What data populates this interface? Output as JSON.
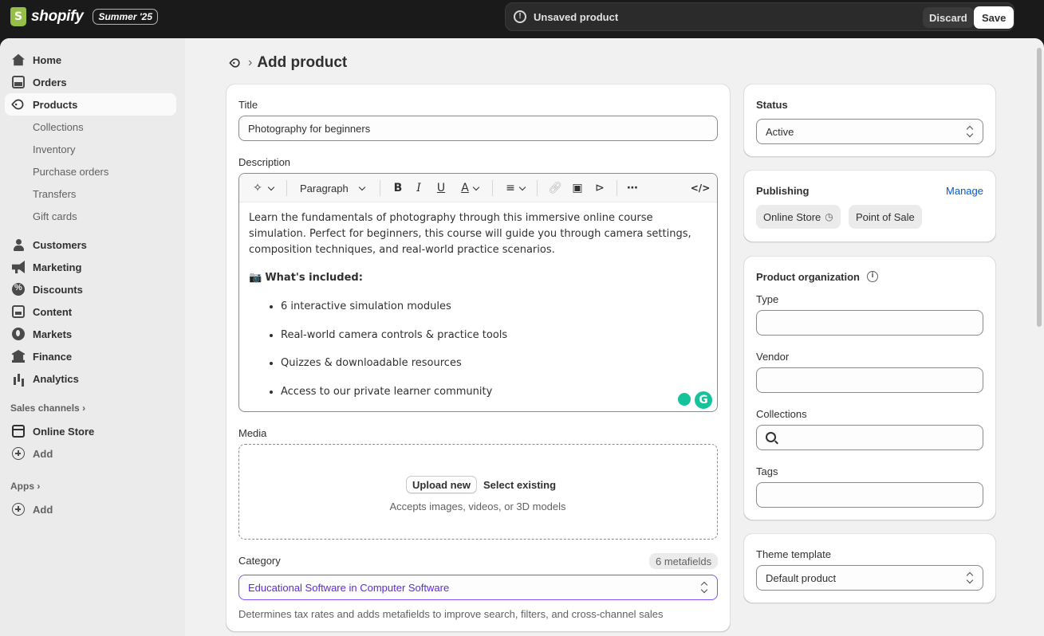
{
  "app": {
    "logo_text": "shopify",
    "badge": "Summer '25"
  },
  "save_bar": {
    "message": "Unsaved product",
    "discard_label": "Discard",
    "save_label": "Save"
  },
  "sidebar": {
    "home": "Home",
    "orders": "Orders",
    "products": "Products",
    "product_subitems": [
      "Collections",
      "Inventory",
      "Purchase orders",
      "Transfers",
      "Gift cards"
    ],
    "customers": "Customers",
    "marketing": "Marketing",
    "discounts": "Discounts",
    "content": "Content",
    "markets": "Markets",
    "finance": "Finance",
    "analytics": "Analytics",
    "sales_channels_label": "Sales channels",
    "online_store": "Online Store",
    "add_channel": "Add",
    "apps_label": "Apps",
    "add_app": "Add"
  },
  "page": {
    "title": "Add product"
  },
  "product": {
    "title_label": "Title",
    "title_value": "Photography for beginners",
    "description_label": "Description",
    "toolbar": {
      "paragraph": "Paragraph"
    },
    "description": {
      "intro": "Learn the fundamentals of photography through this immersive online course simulation. Perfect for beginners, this course will guide you through camera settings, composition techniques, and real-world practice scenarios.",
      "heading_emoji": "📷",
      "heading": "What's included:",
      "bullets": [
        "6 interactive simulation modules",
        "Real-world camera controls & practice tools",
        "Quizzes & downloadable resources",
        "Access to our private learner community"
      ]
    },
    "media_label": "Media",
    "upload_new": "Upload new",
    "select_existing": "Select existing",
    "media_hint": "Accepts images, videos, or 3D models",
    "category_label": "Category",
    "metafields_badge": "6 metafields",
    "category_value": "Educational Software in Computer Software",
    "category_hint": "Determines tax rates and adds metafields to improve search, filters, and cross-channel sales"
  },
  "status_card": {
    "label": "Status",
    "value": "Active"
  },
  "publishing": {
    "label": "Publishing",
    "manage": "Manage",
    "channels": [
      "Online Store",
      "Point of Sale"
    ]
  },
  "organization": {
    "label": "Product organization",
    "type_label": "Type",
    "type_value": "",
    "vendor_label": "Vendor",
    "vendor_value": "",
    "collections_label": "Collections",
    "collections_value": "",
    "tags_label": "Tags",
    "tags_value": ""
  },
  "theme": {
    "label": "Theme template",
    "value": "Default product"
  },
  "colors": {
    "accent_purple": "#8051ff",
    "link_blue": "#005bd3",
    "topbar": "#1a1a1a"
  }
}
